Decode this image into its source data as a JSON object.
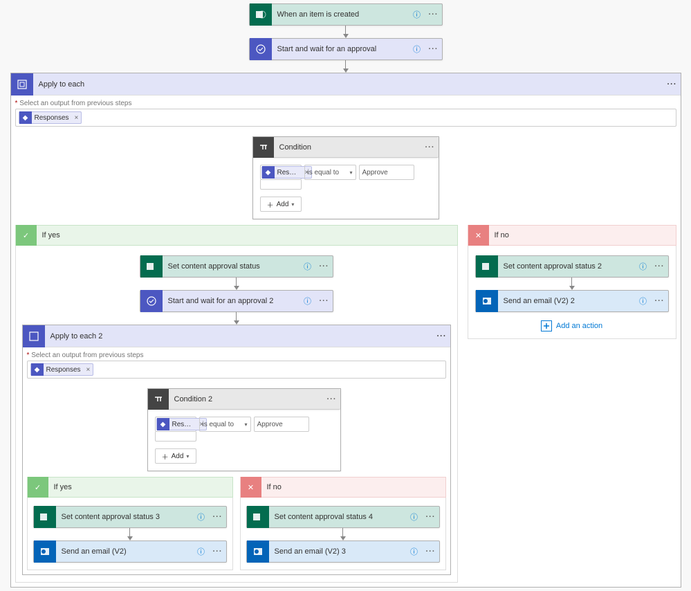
{
  "trigger": {
    "title": "When an item is created"
  },
  "approval1": {
    "title": "Start and wait for an approval"
  },
  "each1": {
    "title": "Apply to each",
    "hint": "Select an output from previous steps",
    "token": "Responses"
  },
  "cond1": {
    "title": "Condition",
    "token": "Respons...",
    "op": "is equal to",
    "value": "Approve",
    "add": "Add"
  },
  "yes1": {
    "label": "If yes",
    "setstatus": "Set content approval status",
    "approval2": "Start and wait for an approval 2",
    "each2": {
      "title": "Apply to each 2",
      "hint": "Select an output from previous steps",
      "token": "Responses"
    },
    "cond2": {
      "title": "Condition 2",
      "token": "Respons...",
      "op": "is equal to",
      "value": "Approve",
      "add": "Add"
    },
    "yes2": {
      "label": "If yes",
      "setstatus": "Set content approval status 3",
      "email": "Send an email (V2)"
    },
    "no2": {
      "label": "If no",
      "setstatus": "Set content approval status 4",
      "email": "Send an email (V2) 3"
    }
  },
  "no1": {
    "label": "If no",
    "setstatus": "Set content approval status 2",
    "email": "Send an email (V2) 2",
    "addaction": "Add an action"
  }
}
